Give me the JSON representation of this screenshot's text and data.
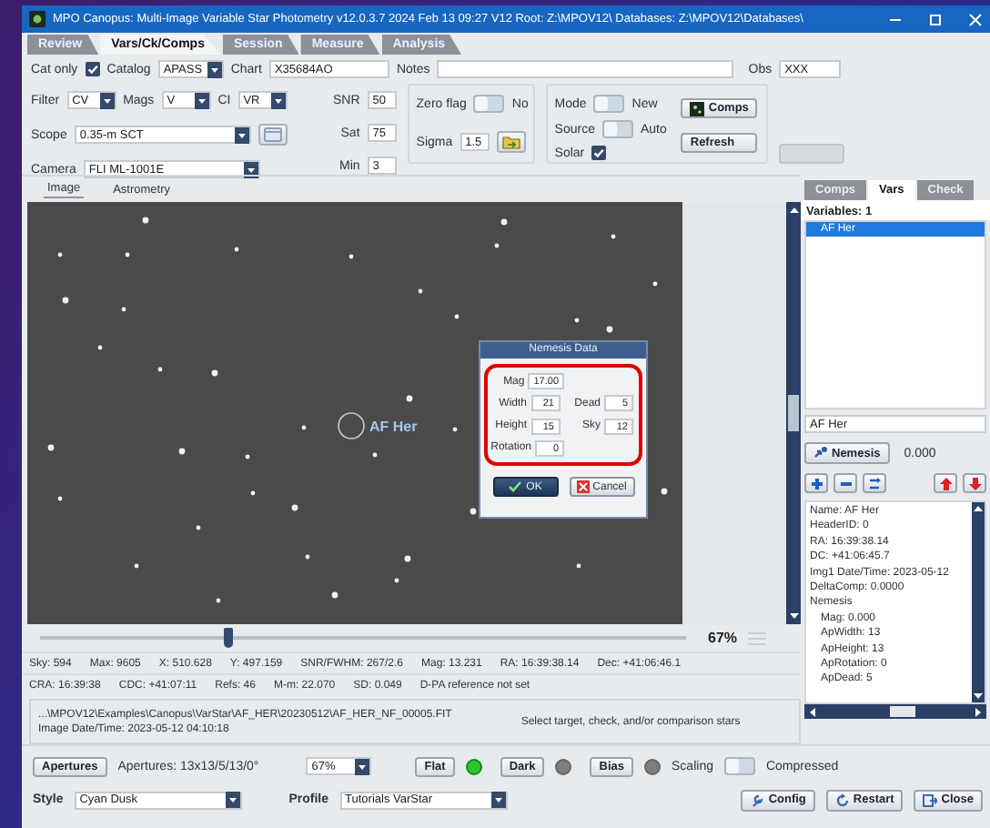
{
  "window": {
    "title": "MPO Canopus: Multi-Image Variable Star Photometry   v12.0.3.7  2024 Feb 13 09:27    V12 Root: Z:\\MPOV12\\   Databases: Z:\\MPOV12\\Databases\\"
  },
  "tabs": [
    {
      "label": "Review",
      "selected": false
    },
    {
      "label": "Vars/Ck/Comps",
      "selected": true
    },
    {
      "label": "Session",
      "selected": false
    },
    {
      "label": "Measure",
      "selected": false
    },
    {
      "label": "Analysis",
      "selected": false
    }
  ],
  "controls": {
    "cat_only": {
      "label": "Cat only",
      "checked": true
    },
    "catalog": {
      "label": "Catalog",
      "value": "APASS"
    },
    "chart": {
      "label": "Chart",
      "value": "X35684AO"
    },
    "notes": {
      "label": "Notes"
    },
    "obs": {
      "label": "Obs",
      "value": "XXX"
    },
    "filter": {
      "label": "Filter",
      "value": "CV"
    },
    "mags": {
      "label": "Mags",
      "value": "V"
    },
    "ci": {
      "label": "CI",
      "value": "VR"
    },
    "scope": {
      "label": "Scope",
      "value": "0.35-m SCT"
    },
    "camera": {
      "label": "Camera",
      "value": "FLI ML-1001E"
    },
    "limits": [
      {
        "label": "SNR",
        "value": "50"
      },
      {
        "label": "Sat",
        "value": "75"
      },
      {
        "label": "Min",
        "value": "3"
      }
    ],
    "zero_flag": {
      "label": "Zero flag",
      "state": "No",
      "on": false
    },
    "sigma": {
      "label": "Sigma",
      "value": "1.5"
    },
    "mode": {
      "label": "Mode",
      "state": "New",
      "on": false
    },
    "source": {
      "label": "Source",
      "state": "Auto",
      "on": false
    },
    "solar": {
      "label": "Solar",
      "checked": true
    },
    "buttons": [
      {
        "label": "Comps",
        "kind": "comps"
      },
      {
        "label": "Refresh",
        "kind": "refresh"
      }
    ],
    "extra_button": {
      "disabled": true
    }
  },
  "image_tabs": [
    {
      "label": "Image",
      "selected": true
    },
    {
      "label": "Astrometry",
      "selected": false
    }
  ],
  "target": {
    "label": "AF Her"
  },
  "dialog": {
    "title": "Nemesis Data",
    "rows": [
      {
        "fields": [
          {
            "label": "Mag",
            "value": "17.00"
          }
        ]
      },
      {
        "fields": [
          {
            "label": "Width",
            "value": "21"
          },
          {
            "label": "Dead",
            "value": "5"
          }
        ]
      },
      {
        "fields": [
          {
            "label": "Height",
            "value": "15"
          },
          {
            "label": "Sky",
            "value": "12"
          }
        ]
      },
      {
        "fields": [
          {
            "label": "Rotation",
            "value": "0"
          }
        ]
      }
    ],
    "buttons": [
      {
        "label": "OK",
        "kind": "ok"
      },
      {
        "label": "Cancel",
        "kind": "cancel"
      }
    ]
  },
  "zoom": {
    "level": 0.29,
    "reading": "67%"
  },
  "readout_rows": [
    {
      "items": [
        "Sky: 594",
        "Max: 9605",
        "X: 510.628",
        "Y: 497.159",
        "SNR/FWHM: 267/2.6",
        "Mag: 13.231",
        "RA: 16:39:38.14",
        "Dec: +41:06:46.1"
      ]
    },
    {
      "items": [
        "CRA: 16:39:38",
        "CDC: +41:07:11",
        "Refs: 46",
        "M-m: 22.070",
        "SD: 0.049",
        "D-PA reference not set"
      ]
    }
  ],
  "file": {
    "path": "...\\MPOV12\\Examples\\Canopus\\VarStar\\AF_HER\\20230512\\AF_HER_NF_00005.FIT",
    "date": "Image Date/Time: 2023-05-12  04:10:18",
    "status": "Select target, check, and/or comparison stars"
  },
  "right_panel": {
    "tabs": [
      {
        "label": "Comps",
        "selected": false
      },
      {
        "label": "Vars",
        "selected": true
      },
      {
        "label": "Check",
        "selected": false
      }
    ],
    "variables_label": "Variables: 1",
    "variables": [
      {
        "label": "AF Her",
        "selected": true
      }
    ],
    "name_field": "AF Her",
    "nemesis_button": "Nemesis",
    "nemesis_value": "0.000",
    "info": [
      {
        "text": "Name: AF Her"
      },
      {
        "text": "HeaderID: 0"
      },
      {
        "text": "RA: 16:39:38.14"
      },
      {
        "text": "DC: +41:06:45.7"
      },
      {
        "text": "Img1 Date/Time: 2023-05-12"
      },
      {
        "text": "DeltaComp: 0.0000"
      },
      {
        "text": "Nemesis",
        "children": [
          {
            "text": "Mag: 0.000"
          },
          {
            "text": "ApWidth: 13"
          },
          {
            "text": "ApHeight: 13"
          },
          {
            "text": "ApRotation: 0"
          },
          {
            "text": "ApDead: 5"
          }
        ]
      }
    ]
  },
  "bottom": {
    "apertures_button": "Apertures",
    "apertures": "Apertures: 13x13/5/13/0°",
    "zoom_select": "67%",
    "calibration": [
      {
        "label": "Flat",
        "on": true
      },
      {
        "label": "Dark",
        "on": false
      },
      {
        "label": "Bias",
        "on": false
      }
    ],
    "scaling": {
      "label": "Scaling",
      "state": "Compressed",
      "on": false
    }
  },
  "footer": {
    "style": {
      "label": "Style",
      "value": "Cyan Dusk"
    },
    "profile": {
      "label": "Profile",
      "value": "Tutorials VarStar"
    },
    "buttons": [
      {
        "label": "Config",
        "kind": "config"
      },
      {
        "label": "Restart",
        "kind": "restart"
      },
      {
        "label": "Close",
        "kind": "close"
      }
    ]
  }
}
